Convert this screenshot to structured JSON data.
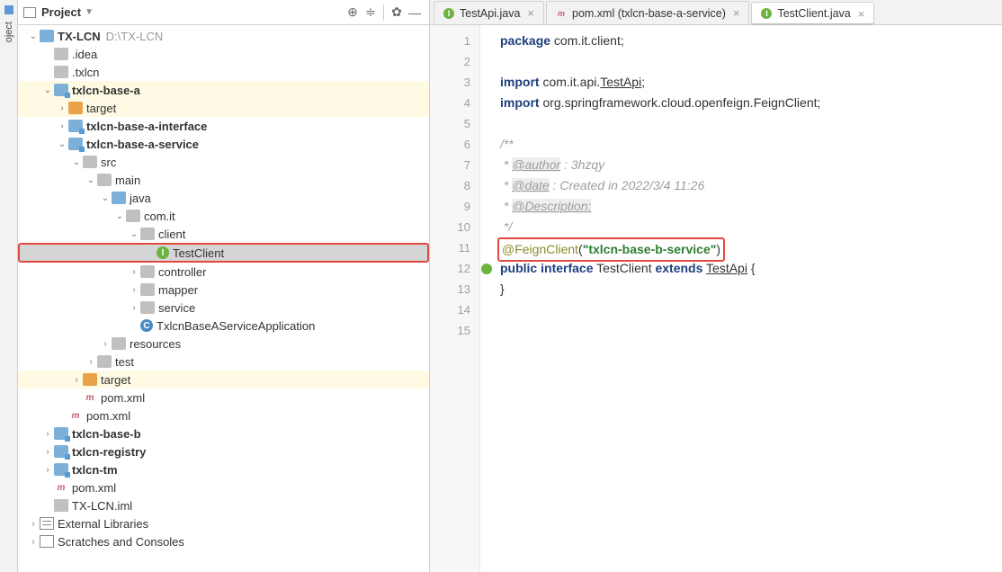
{
  "sidetab": {
    "label": "oject"
  },
  "project_header": {
    "title": "Project",
    "btn_target": "⊕",
    "btn_collapse": "≑",
    "btn_settings": "✿",
    "btn_hide": "—"
  },
  "tree": [
    {
      "indent": 0,
      "arrow": "v",
      "icon": "root-proj",
      "label": "TX-LCN",
      "dim": "D:\\TX-LCN",
      "bold": 1
    },
    {
      "indent": 1,
      "arrow": "",
      "icon": "folder-gray",
      "label": ".idea"
    },
    {
      "indent": 1,
      "arrow": "",
      "icon": "folder-gray",
      "label": ".txlcn"
    },
    {
      "indent": 1,
      "arrow": "v",
      "icon": "module",
      "label": "txlcn-base-a",
      "hl": "yellow",
      "bold": 1
    },
    {
      "indent": 2,
      "arrow": ">",
      "icon": "folder-orange",
      "label": "target",
      "hl": "yellow"
    },
    {
      "indent": 2,
      "arrow": ">",
      "icon": "module",
      "label": "txlcn-base-a-interface",
      "bold": 1
    },
    {
      "indent": 2,
      "arrow": "v",
      "icon": "module",
      "label": "txlcn-base-a-service",
      "bold": 1
    },
    {
      "indent": 3,
      "arrow": "v",
      "icon": "folder-gray",
      "label": "src"
    },
    {
      "indent": 4,
      "arrow": "v",
      "icon": "folder-gray",
      "label": "main"
    },
    {
      "indent": 5,
      "arrow": "v",
      "icon": "folder-blue",
      "label": "java"
    },
    {
      "indent": 6,
      "arrow": "v",
      "icon": "package",
      "label": "com.it"
    },
    {
      "indent": 7,
      "arrow": "v",
      "icon": "package",
      "label": "client"
    },
    {
      "indent": 8,
      "arrow": "",
      "icon": "interface",
      "iconText": "I",
      "label": "TestClient",
      "selected": 1,
      "redbox": 1
    },
    {
      "indent": 7,
      "arrow": ">",
      "icon": "package",
      "label": "controller"
    },
    {
      "indent": 7,
      "arrow": ">",
      "icon": "package",
      "label": "mapper"
    },
    {
      "indent": 7,
      "arrow": ">",
      "icon": "package",
      "label": "service"
    },
    {
      "indent": 7,
      "arrow": "",
      "icon": "class",
      "iconText": "C",
      "label": "TxlcnBaseAServiceApplication"
    },
    {
      "indent": 5,
      "arrow": ">",
      "icon": "folder-gray",
      "label": "resources"
    },
    {
      "indent": 4,
      "arrow": ">",
      "icon": "folder-gray",
      "label": "test"
    },
    {
      "indent": 3,
      "arrow": ">",
      "icon": "folder-orange",
      "label": "target",
      "hl": "yellow"
    },
    {
      "indent": 3,
      "arrow": "",
      "icon": "maven",
      "iconText": "m",
      "label": "pom.xml"
    },
    {
      "indent": 2,
      "arrow": "",
      "icon": "maven",
      "iconText": "m",
      "label": "pom.xml"
    },
    {
      "indent": 1,
      "arrow": ">",
      "icon": "module",
      "label": "txlcn-base-b",
      "bold": 1
    },
    {
      "indent": 1,
      "arrow": ">",
      "icon": "module",
      "label": "txlcn-registry",
      "bold": 1
    },
    {
      "indent": 1,
      "arrow": ">",
      "icon": "module",
      "label": "txlcn-tm",
      "bold": 1
    },
    {
      "indent": 1,
      "arrow": "",
      "icon": "maven",
      "iconText": "m",
      "label": "pom.xml"
    },
    {
      "indent": 1,
      "arrow": "",
      "icon": "iml",
      "label": "TX-LCN.iml"
    },
    {
      "indent": 0,
      "arrow": ">",
      "icon": "libs",
      "label": "External Libraries"
    },
    {
      "indent": 0,
      "arrow": ">",
      "icon": "scratch",
      "label": "Scratches and Consoles"
    }
  ],
  "tabs": [
    {
      "icon": "interface",
      "iconText": "I",
      "label": "TestApi.java",
      "close": "×"
    },
    {
      "icon": "maven",
      "iconText": "m",
      "label": "pom.xml (txlcn-base-a-service)",
      "close": "×"
    },
    {
      "icon": "interface",
      "iconText": "I",
      "label": "TestClient.java",
      "close": "×",
      "active": 1
    }
  ],
  "gutter": {
    "lines": [
      "1",
      "2",
      "3",
      "4",
      "5",
      "6",
      "7",
      "8",
      "9",
      "10",
      "11",
      "12",
      "13",
      "14",
      "15"
    ],
    "markers": {
      "12": "impl"
    }
  },
  "code": {
    "l1": {
      "kw": "package",
      "rest": " com.it.client;"
    },
    "l3": {
      "kw": "import",
      "rest1": " com.it.api.",
      "ref": "TestApi",
      "rest2": ";"
    },
    "l4": {
      "kw": "import",
      "rest": " org.springframework.cloud.openfeign.FeignClient;"
    },
    "l6": "/**",
    "l7": {
      "pre": " * ",
      "tag": "@author",
      "rest": " : 3hzqy"
    },
    "l8": {
      "pre": " * ",
      "tag": "@date",
      "rest": " : Created in 2022/3/4 11:26"
    },
    "l9": {
      "pre": " * ",
      "tag": "@Description:"
    },
    "l10": " */",
    "l11": {
      "anno": "@FeignClient",
      "open": "(",
      "str": "\"txlcn-base-b-service\"",
      "close": ")"
    },
    "l12": {
      "kw1": "public",
      "kw2": "interface",
      "name": " TestClient ",
      "kw3": "extends",
      "ref": "TestApi",
      "rest": " {"
    },
    "l13": "}"
  }
}
